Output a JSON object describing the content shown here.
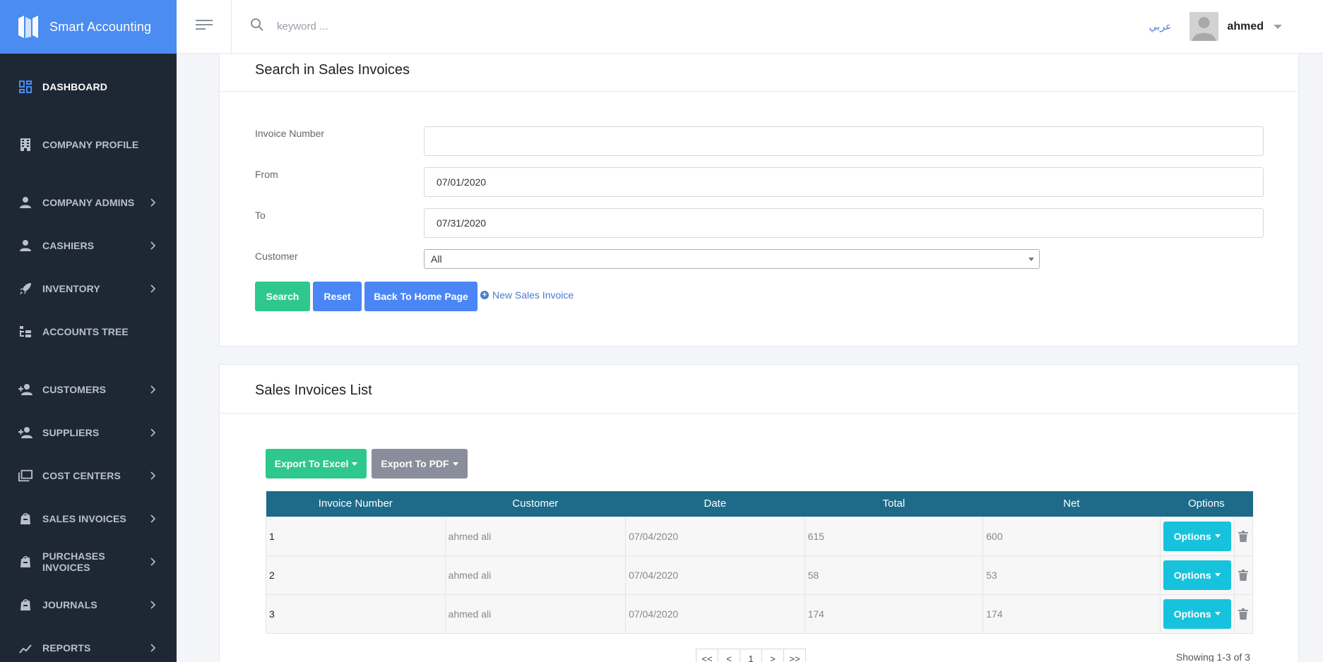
{
  "app": {
    "brand_name": "Smart Accounting",
    "accent_color": "#4a8cf0",
    "sidebar_color": "#1e2835"
  },
  "header": {
    "search_placeholder": "keyword ...",
    "language_link": "عربي",
    "user_name": "ahmed"
  },
  "sidebar": {
    "items": [
      {
        "label": "DASHBOARD",
        "icon": "dashboard-icon",
        "active": true,
        "has_children": false
      },
      {
        "label": "COMPANY PROFILE",
        "icon": "building-icon",
        "active": false,
        "has_children": false
      },
      {
        "label": "COMPANY ADMINS",
        "icon": "person-icon",
        "active": false,
        "has_children": true
      },
      {
        "label": "CASHIERS",
        "icon": "person-icon",
        "active": false,
        "has_children": true
      },
      {
        "label": "INVENTORY",
        "icon": "rocket-icon",
        "active": false,
        "has_children": true
      },
      {
        "label": "ACCOUNTS TREE",
        "icon": "tree-icon",
        "active": false,
        "has_children": false
      },
      {
        "label": "CUSTOMERS",
        "icon": "person-add-icon",
        "active": false,
        "has_children": true
      },
      {
        "label": "SUPPLIERS",
        "icon": "person-add-icon",
        "active": false,
        "has_children": true
      },
      {
        "label": "COST CENTERS",
        "icon": "folders-icon",
        "active": false,
        "has_children": true
      },
      {
        "label": "SALES INVOICES",
        "icon": "shopping-bag-icon",
        "active": false,
        "has_children": true
      },
      {
        "label": "PURCHASES INVOICES",
        "icon": "shopping-bag-icon",
        "active": false,
        "has_children": true
      },
      {
        "label": "JOURNALS",
        "icon": "shopping-bag-icon",
        "active": false,
        "has_children": true
      },
      {
        "label": "REPORTS",
        "icon": "chart-icon",
        "active": false,
        "has_children": true
      }
    ]
  },
  "search_section": {
    "title": "Search in Sales Invoices",
    "invoice_number_label": "Invoice Number",
    "invoice_number_value": "",
    "from_label": "From",
    "from_value": "07/01/2020",
    "to_label": "To",
    "to_value": "07/31/2020",
    "customer_label": "Customer",
    "customer_value": "All",
    "search_button": "Search",
    "reset_button": "Reset",
    "back_button": "Back To Home Page",
    "new_invoice_link": "New Sales Invoice"
  },
  "list_section": {
    "title": "Sales Invoices List",
    "export_excel": "Export To Excel",
    "export_pdf": "Export To PDF",
    "columns": [
      "Invoice Number",
      "Customer",
      "Date",
      "Total",
      "Net",
      "Options"
    ],
    "rows": [
      {
        "invoice_number": "1",
        "customer": "ahmed ali",
        "date": "07/04/2020",
        "total": "615",
        "net": "600",
        "options": "Options"
      },
      {
        "invoice_number": "2",
        "customer": "ahmed ali",
        "date": "07/04/2020",
        "total": "58",
        "net": "53",
        "options": "Options"
      },
      {
        "invoice_number": "3",
        "customer": "ahmed ali",
        "date": "07/04/2020",
        "total": "174",
        "net": "174",
        "options": "Options"
      }
    ],
    "pager": [
      "<<",
      "<",
      "1",
      ">",
      ">>"
    ],
    "showing": "Showing 1-3 of 3"
  }
}
